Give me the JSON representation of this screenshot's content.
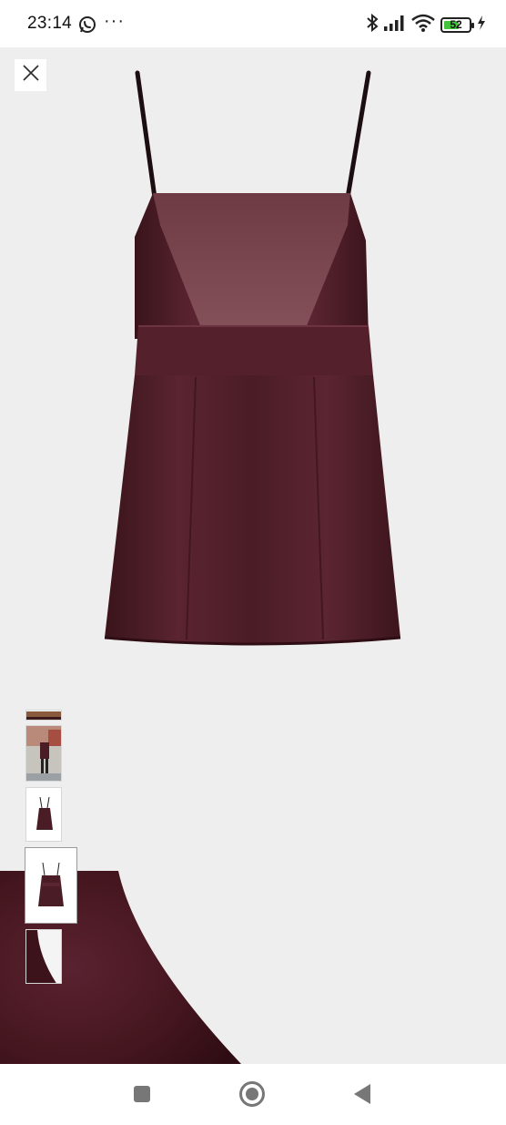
{
  "status_bar": {
    "time": "23:14",
    "battery_level": "52",
    "icons": [
      "whatsapp-icon",
      "more-dots-icon",
      "bluetooth-icon",
      "signal-icon",
      "wifi-icon",
      "battery-icon",
      "charging-icon"
    ],
    "more_glyph": "···"
  },
  "viewer": {
    "background": "#efeeee",
    "product_color": "#4a1b24",
    "close_icon": "close-icon",
    "thumbnails": [
      {
        "kind": "partial-photo"
      },
      {
        "kind": "street-photo"
      },
      {
        "kind": "dress-small"
      },
      {
        "kind": "dress-back",
        "selected": true
      },
      {
        "kind": "fabric-detail"
      }
    ]
  },
  "nav_bar": {
    "icons": [
      "recents-square-icon",
      "home-circle-icon",
      "back-triangle-icon"
    ]
  }
}
